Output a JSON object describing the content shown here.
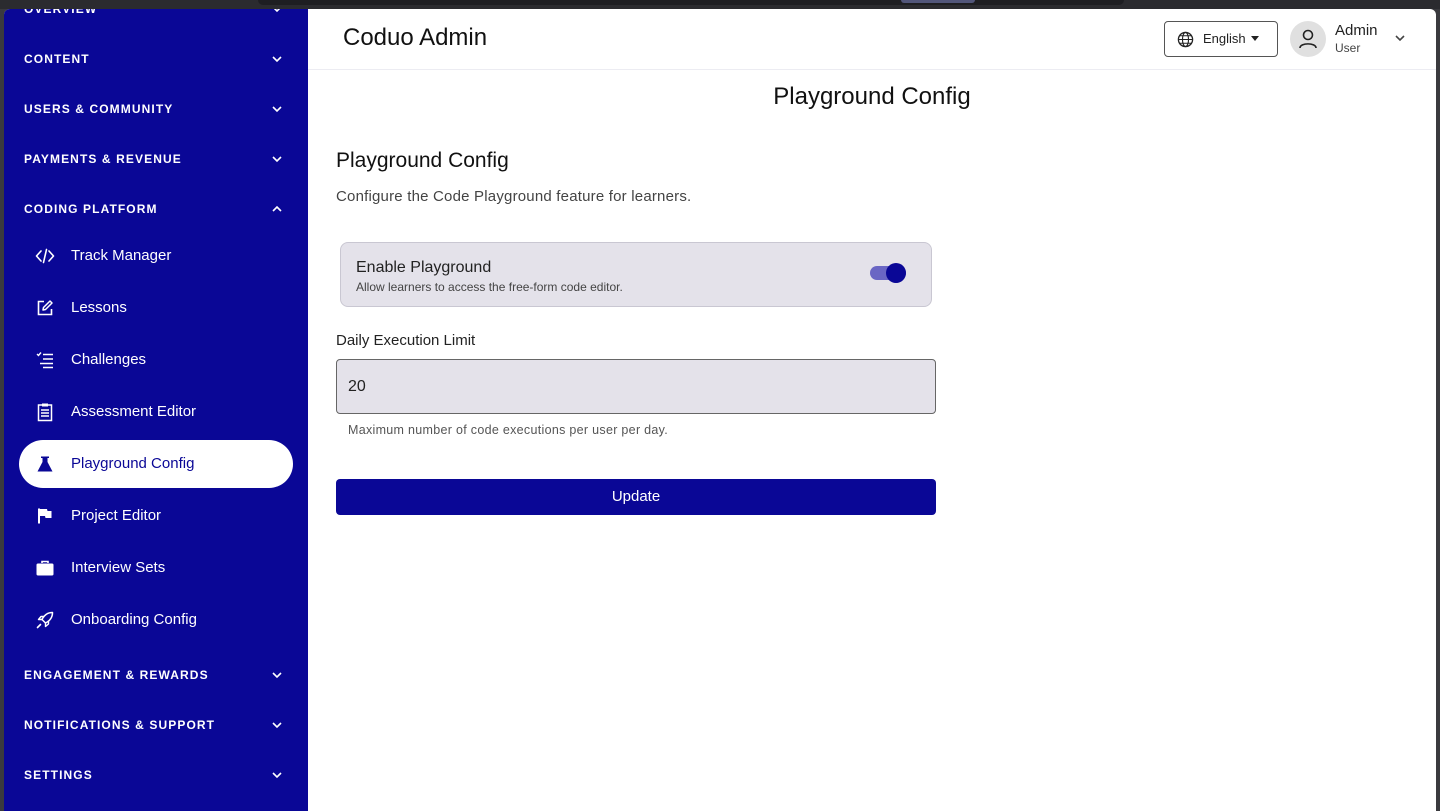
{
  "app": {
    "brand": "Coduo Admin"
  },
  "colors": {
    "primary": "#0a0796",
    "surface": "#e4e2ea",
    "toggle_track": "#6a66c4"
  },
  "sidebar": {
    "sections": [
      {
        "label": "OVERVIEW",
        "expanded": false
      },
      {
        "label": "CONTENT",
        "expanded": false
      },
      {
        "label": "USERS & COMMUNITY",
        "expanded": false
      },
      {
        "label": "PAYMENTS & REVENUE",
        "expanded": false
      },
      {
        "label": "CODING PLATFORM",
        "expanded": true
      },
      {
        "label": "ENGAGEMENT & REWARDS",
        "expanded": false
      },
      {
        "label": "NOTIFICATIONS & SUPPORT",
        "expanded": false
      },
      {
        "label": "SETTINGS",
        "expanded": false
      }
    ],
    "items": [
      {
        "label": "Track Manager",
        "icon": "code-icon"
      },
      {
        "label": "Lessons",
        "icon": "edit-icon"
      },
      {
        "label": "Challenges",
        "icon": "checklist-icon"
      },
      {
        "label": "Assessment Editor",
        "icon": "clipboard-icon"
      },
      {
        "label": "Playground Config",
        "icon": "flask-icon",
        "active": true
      },
      {
        "label": "Project Editor",
        "icon": "flag-icon"
      },
      {
        "label": "Interview Sets",
        "icon": "briefcase-icon"
      },
      {
        "label": "Onboarding Config",
        "icon": "rocket-icon"
      }
    ]
  },
  "header": {
    "language": "English",
    "user": {
      "name": "Admin",
      "role": "User"
    }
  },
  "page": {
    "title": "Playground Config",
    "card_title": "Playground Config",
    "card_description": "Configure the Code Playground feature for learners.",
    "toggle": {
      "label": "Enable Playground",
      "description": "Allow learners to access the free-form code editor.",
      "enabled": true
    },
    "limit_field": {
      "label": "Daily Execution Limit",
      "value": "20",
      "helper": "Maximum number of code executions per user per day."
    },
    "update_button": "Update"
  }
}
